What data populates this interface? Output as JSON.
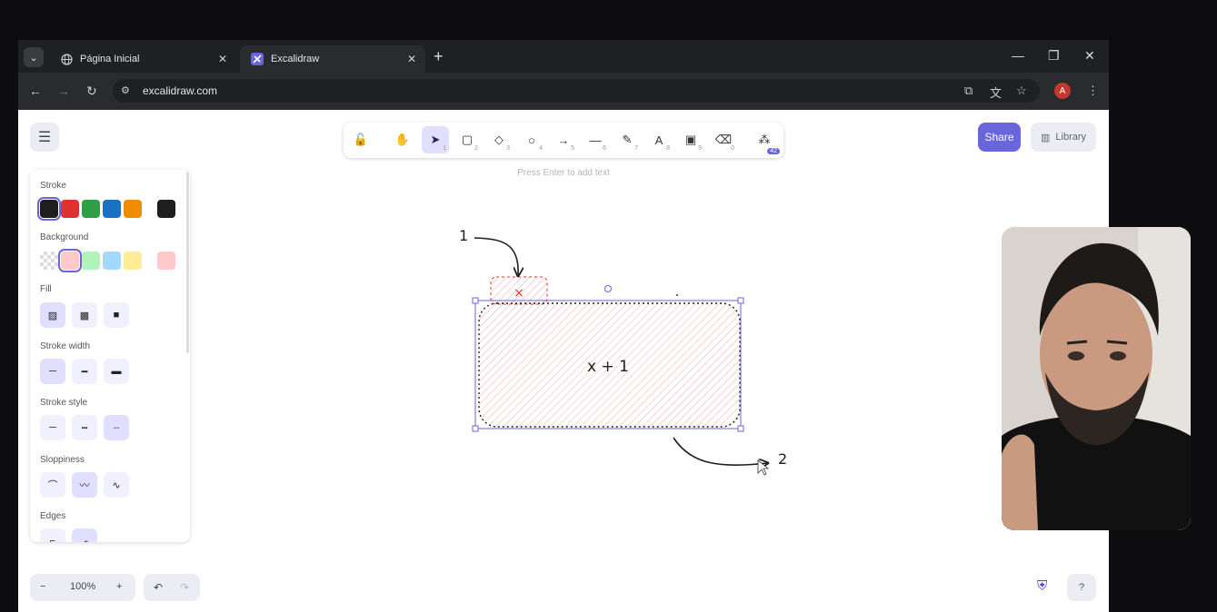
{
  "browser": {
    "tabs": [
      {
        "label": "Página Inicial",
        "icon": "globe-icon",
        "active": false
      },
      {
        "label": "Excalidraw",
        "icon": "excalidraw-icon",
        "active": true
      }
    ],
    "new_tab_label": "+",
    "url": "excalidraw.com",
    "profile_initial": "A"
  },
  "toolbar": {
    "tools": [
      {
        "name": "lock",
        "icon": "lock-icon",
        "glyph": "🔓",
        "num": ""
      },
      {
        "name": "hand",
        "icon": "hand-icon",
        "glyph": "✋",
        "num": ""
      },
      {
        "name": "selection",
        "icon": "pointer-icon",
        "glyph": "➤",
        "num": "1"
      },
      {
        "name": "rectangle",
        "icon": "rectangle-icon",
        "glyph": "▢",
        "num": "2"
      },
      {
        "name": "diamond",
        "icon": "diamond-icon",
        "glyph": "◇",
        "num": "3"
      },
      {
        "name": "ellipse",
        "icon": "ellipse-icon",
        "glyph": "○",
        "num": "4"
      },
      {
        "name": "arrow",
        "icon": "arrow-icon",
        "glyph": "→",
        "num": "5"
      },
      {
        "name": "line",
        "icon": "line-icon",
        "glyph": "—",
        "num": "6"
      },
      {
        "name": "draw",
        "icon": "pencil-icon",
        "glyph": "✎",
        "num": "7"
      },
      {
        "name": "text",
        "icon": "text-icon",
        "glyph": "A",
        "num": "8"
      },
      {
        "name": "image",
        "icon": "image-icon",
        "glyph": "▣",
        "num": "9"
      },
      {
        "name": "eraser",
        "icon": "eraser-icon",
        "glyph": "⌫",
        "num": "0"
      },
      {
        "name": "more",
        "icon": "shapes-icon",
        "glyph": "⁂",
        "num": ""
      }
    ],
    "active_tool": "selection",
    "more_badge": "42",
    "hint": "Press Enter to add text"
  },
  "header": {
    "share_label": "Share",
    "library_label": "Library"
  },
  "properties": {
    "stroke_label": "Stroke",
    "stroke_colors": [
      "#1e1e1e",
      "#e03131",
      "#2f9e44",
      "#1971c2",
      "#f08c00"
    ],
    "stroke_current": "#1e1e1e",
    "background_label": "Background",
    "background_colors": [
      "transparent",
      "#ffc9c9",
      "#b2f2bb",
      "#a5d8ff",
      "#ffec99"
    ],
    "background_current": "#ffc9c9",
    "fill_label": "Fill",
    "stroke_width_label": "Stroke width",
    "stroke_style_label": "Stroke style",
    "sloppiness_label": "Sloppiness",
    "edges_label": "Edges"
  },
  "footer": {
    "zoom_minus": "−",
    "zoom_level": "100%",
    "zoom_plus": "+"
  },
  "canvas": {
    "shape_text": "x + 1",
    "label_one": "1",
    "label_two": "2",
    "small_box_mark": "×"
  },
  "colors": {
    "accent": "#6965db",
    "selection": "#6965db",
    "shape_fill": "#ffc9c9",
    "shape_stroke": "#1e1e1e"
  }
}
